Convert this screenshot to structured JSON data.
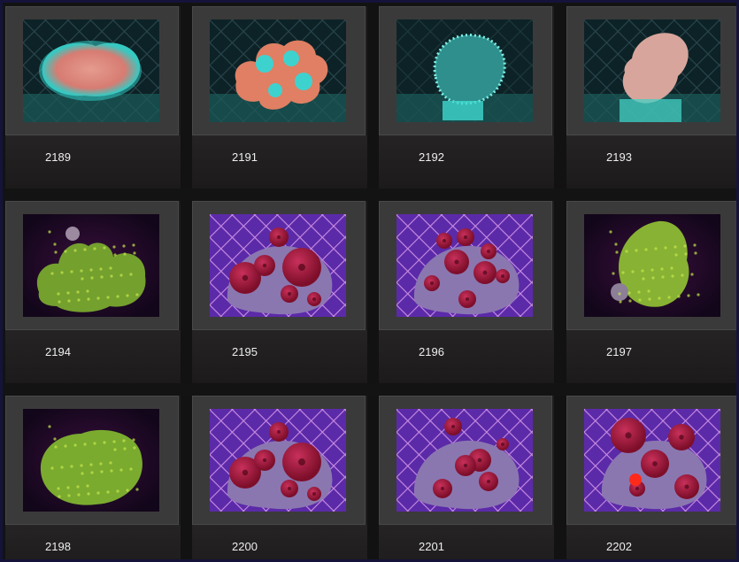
{
  "gallery": {
    "items": [
      {
        "label": "2189",
        "style": "softcoral-cyan"
      },
      {
        "label": "2191",
        "style": "lobed-cyan"
      },
      {
        "label": "2192",
        "style": "fuzzy-teal"
      },
      {
        "label": "2193",
        "style": "softcoral-pale"
      },
      {
        "label": "2194",
        "style": "green-clump"
      },
      {
        "label": "2195",
        "style": "red-mushrooms"
      },
      {
        "label": "2196",
        "style": "red-mushrooms-dense"
      },
      {
        "label": "2197",
        "style": "green-mound"
      },
      {
        "label": "2198",
        "style": "green-flat"
      },
      {
        "label": "2200",
        "style": "red-mushrooms"
      },
      {
        "label": "2201",
        "style": "red-mushrooms-rock"
      },
      {
        "label": "2202",
        "style": "red-mushrooms-large"
      }
    ]
  },
  "colors": {
    "card_bg": "#1f1d1d",
    "thumb_frame": "#3b3a3a",
    "label_text": "#eeeeee",
    "window_border": "#15133a"
  }
}
